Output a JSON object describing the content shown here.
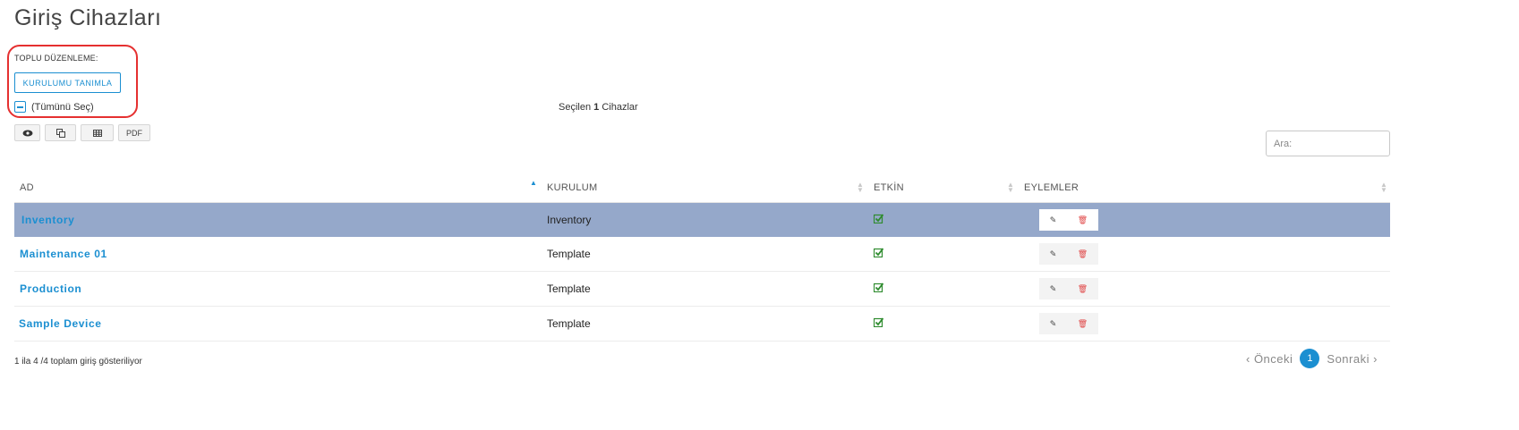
{
  "page": {
    "title": "Giriş Cihazları"
  },
  "bulk": {
    "label": "TOPLU DÜZENLEME:",
    "define_button": "KURULUMU TANIMLA",
    "select_all": "(Tümünü Seç)"
  },
  "selection": {
    "prefix": "Seçilen",
    "count": "1",
    "suffix": "Cihazlar"
  },
  "toolbar": {
    "pdf_label": "PDF"
  },
  "search": {
    "placeholder": "Ara:",
    "value": ""
  },
  "table": {
    "columns": [
      "AD",
      "KURULUM",
      "ETKİN",
      "EYLEMLER"
    ],
    "sorted_column": "AD",
    "rows": [
      {
        "name": "Inventory",
        "setup": "Inventory",
        "enabled": true,
        "selected": true
      },
      {
        "name": "Maintenance 01",
        "setup": "Template",
        "enabled": true,
        "selected": false
      },
      {
        "name": "Production",
        "setup": "Template",
        "enabled": true,
        "selected": false
      },
      {
        "name": "Sample Device",
        "setup": "Template",
        "enabled": true,
        "selected": false
      }
    ]
  },
  "footer": {
    "info": "1 ila 4 /4 toplam giriş gösteriliyor"
  },
  "pagination": {
    "prev": "‹ Önceki",
    "current": "1",
    "next": "Sonraki ›"
  },
  "colors": {
    "accent": "#1b8fd1",
    "selected_row": "#95a8ca",
    "highlight_box": "#e53030",
    "check": "#2e8b2e",
    "delete": "#e04545"
  },
  "icons": {
    "view": "eye-icon",
    "copy": "copy-icon",
    "excel": "table-icon",
    "edit": "edit-icon",
    "delete": "trash-icon",
    "enabled": "check-square-icon"
  }
}
